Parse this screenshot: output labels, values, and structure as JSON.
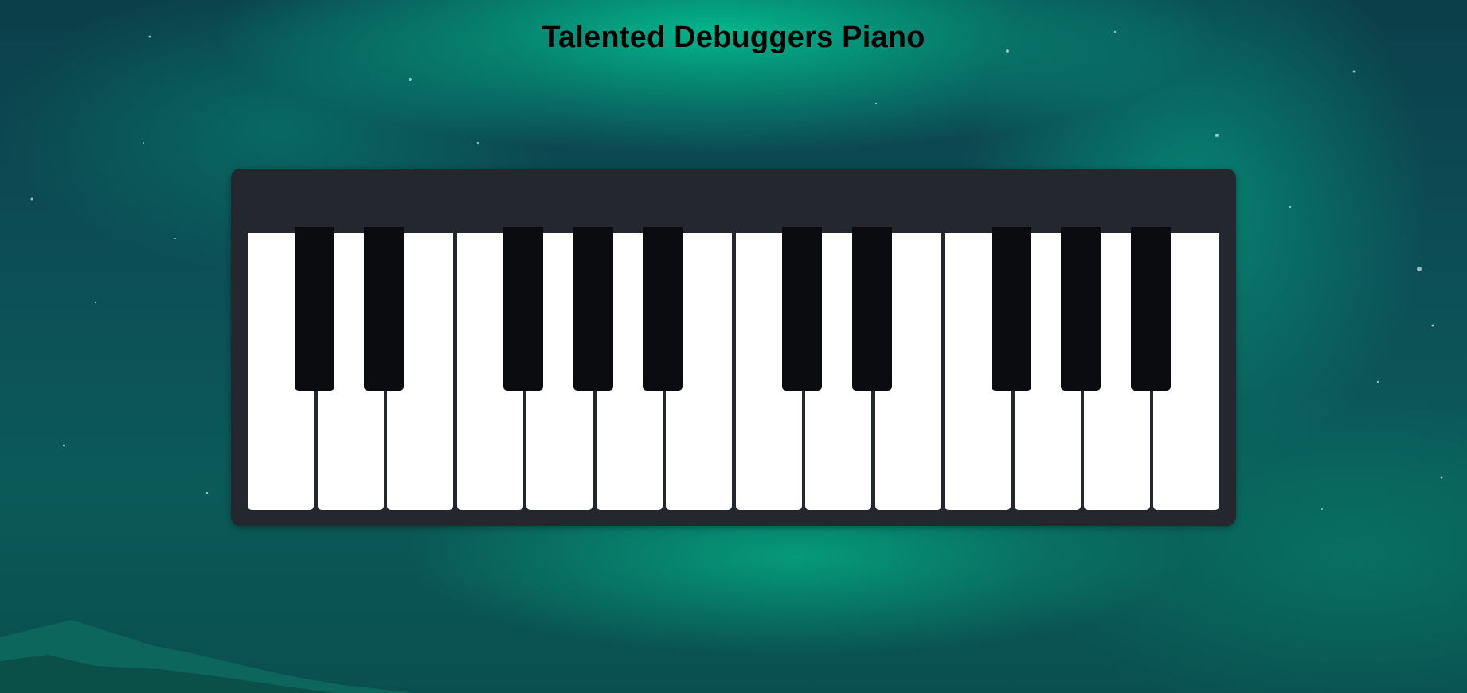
{
  "title": "Talented Debuggers Piano",
  "colors": {
    "piano_body": "#25272e",
    "white_key": "#ffffff",
    "black_key": "#0a0c10",
    "title_text": "#000000"
  },
  "piano": {
    "white_key_count": 14,
    "black_key_count": 10
  }
}
